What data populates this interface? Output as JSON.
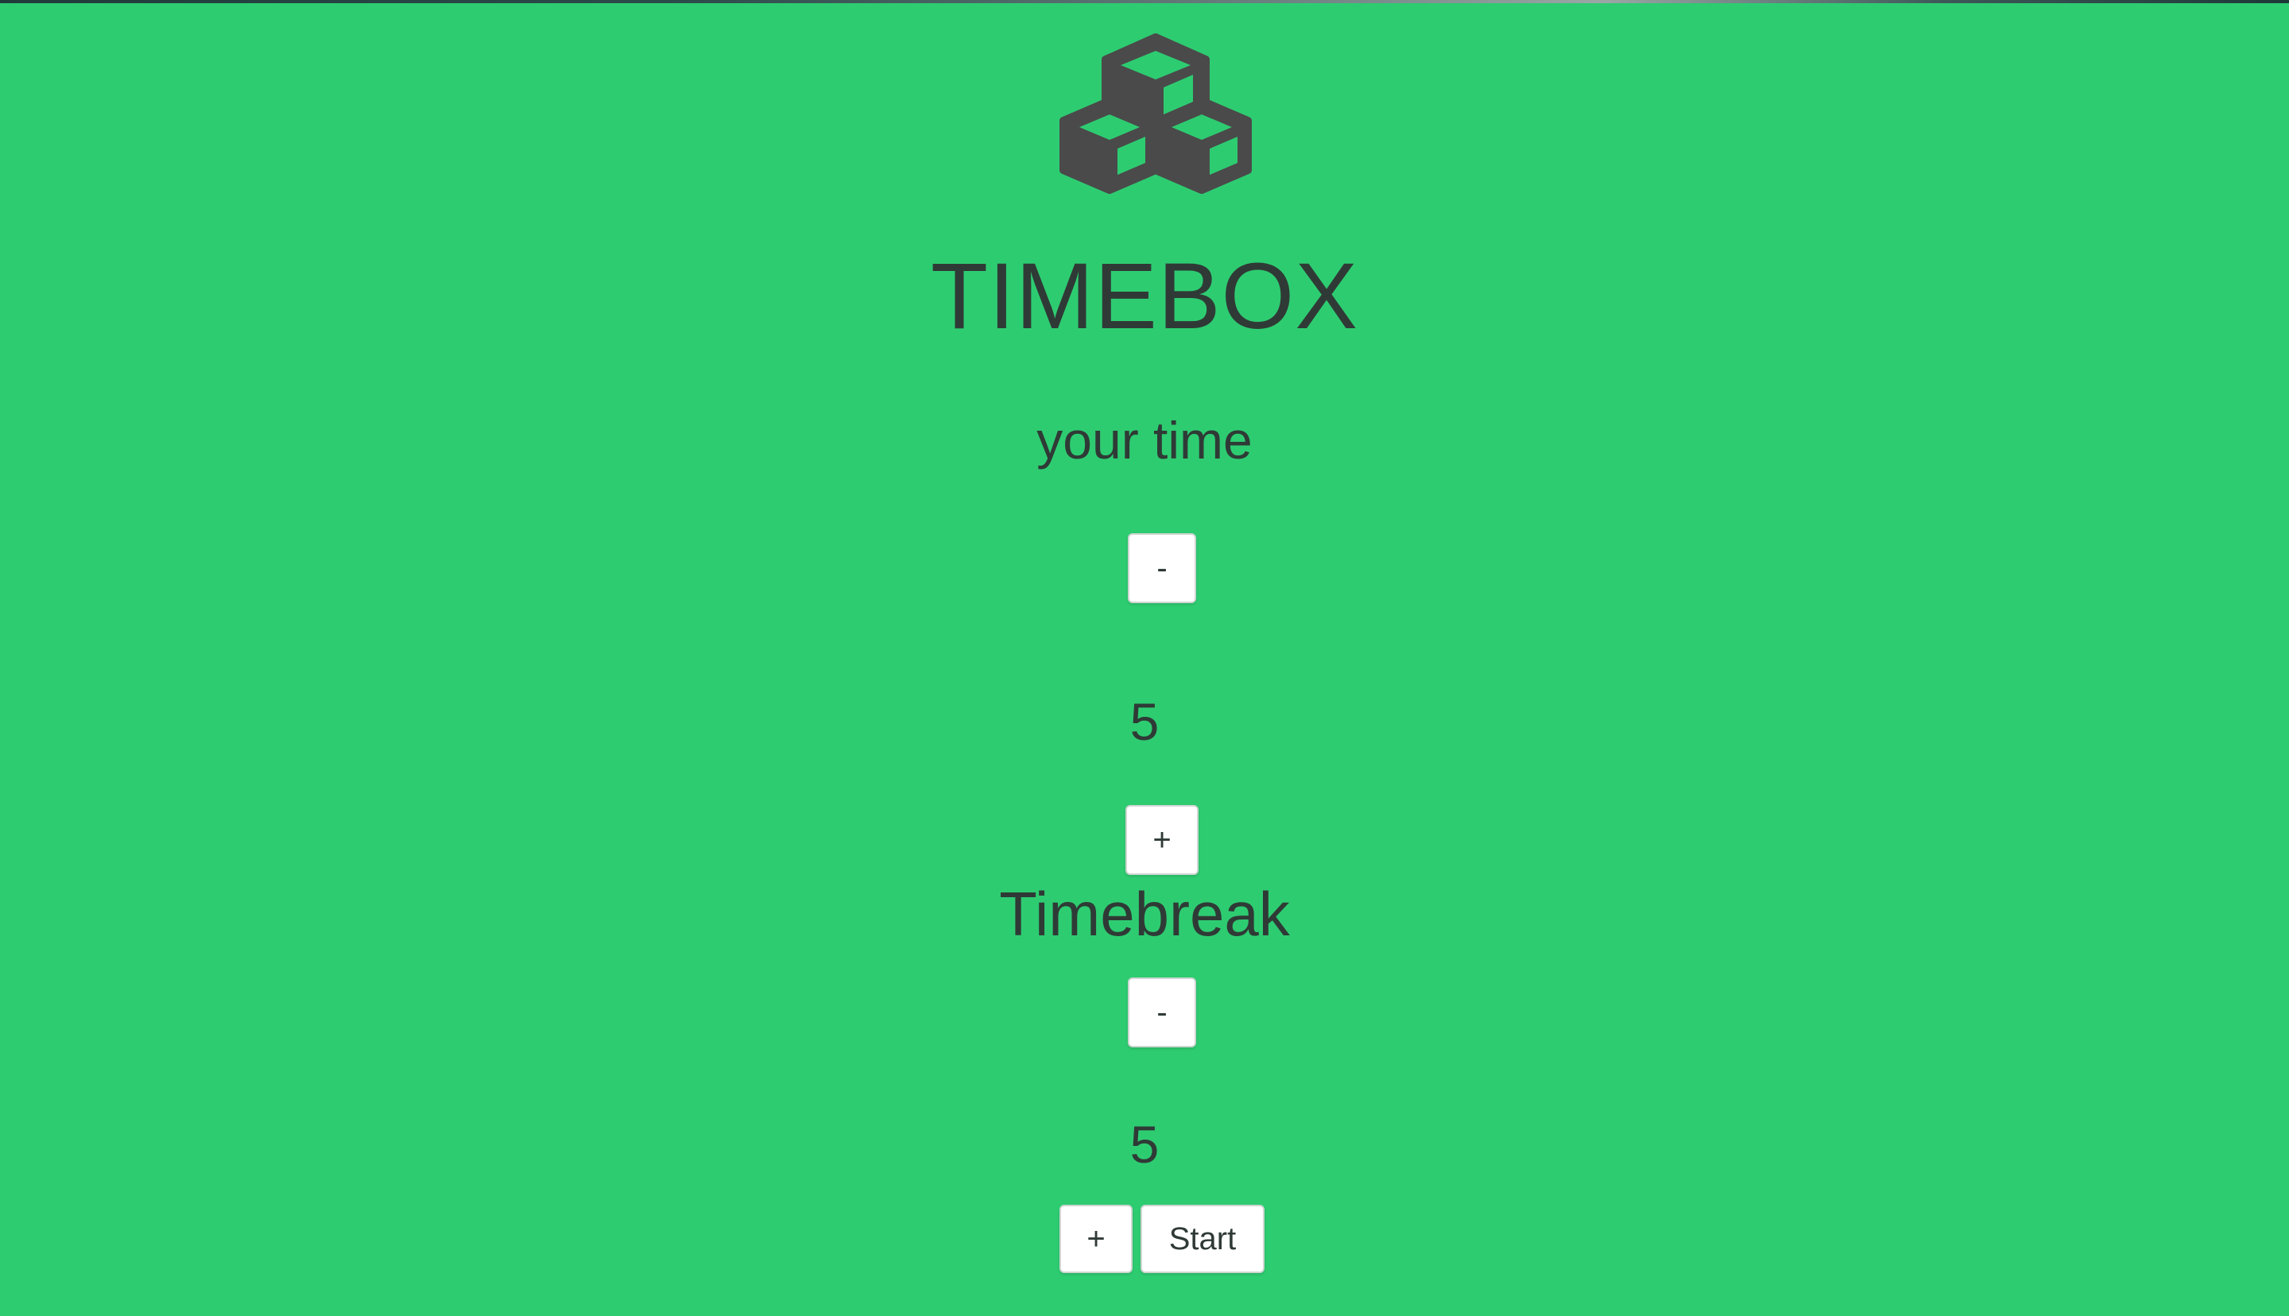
{
  "app": {
    "title": "TIMEBOX",
    "logo_icon": "cubes-icon",
    "background_color": "#2ecc71",
    "text_color": "#2f3a36",
    "logo_color": "#4a4a4a"
  },
  "work": {
    "label": "your time",
    "decrement_label": "-",
    "value": "5",
    "increment_label": "+"
  },
  "break": {
    "label": "Timebreak",
    "decrement_label": "-",
    "value": "5",
    "increment_label": "+"
  },
  "controls": {
    "start_label": "Start"
  }
}
